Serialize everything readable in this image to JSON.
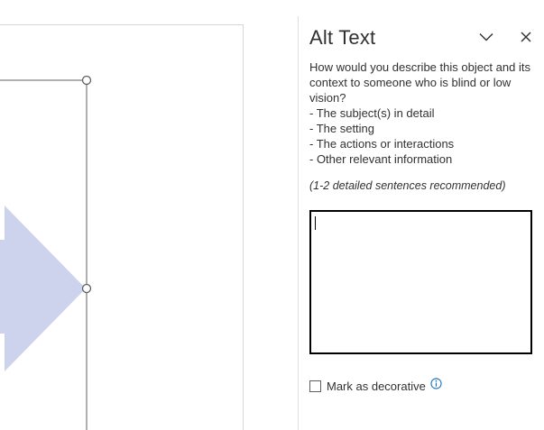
{
  "pane": {
    "title": "Alt Text",
    "options_icon": "chevron-down-icon",
    "close_icon": "close-icon",
    "description": "How would you describe this object and its context to someone who is blind or low vision?",
    "bullets": [
      "- The subject(s) in detail",
      "- The setting",
      "- The actions or interactions",
      "- Other relevant information"
    ],
    "hint": "(1-2 detailed sentences recommended)",
    "alt_text_value": "",
    "decorative_label": "Mark as decorative",
    "decorative_checked": false,
    "info_icon": "info-icon"
  },
  "canvas": {
    "shape": "arrow-shape",
    "shape_color": "#cdd3ec",
    "selected": true
  },
  "colors": {
    "accent": "#0f6cbd",
    "text": "#323130",
    "divider": "#e1dfdd"
  }
}
